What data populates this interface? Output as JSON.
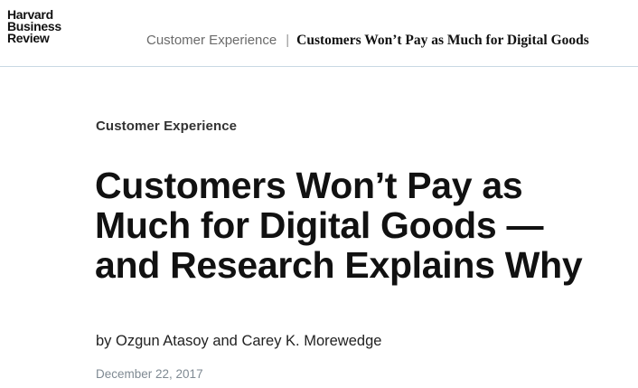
{
  "header": {
    "logo": {
      "line1": "Harvard",
      "line2": "Business",
      "line3": "Review"
    },
    "breadcrumb": {
      "topic": "Customer Experience",
      "separator": "|",
      "title": "Customers Won’t Pay as Much for Digital Goods"
    }
  },
  "article": {
    "topic": "Customer Experience",
    "headline": "Customers Won’t Pay as Much for Digital Goods — and Research Explains Why",
    "byline": "by Ozgun Atasoy and Carey K. Morewedge",
    "date": "December 22, 2017"
  }
}
